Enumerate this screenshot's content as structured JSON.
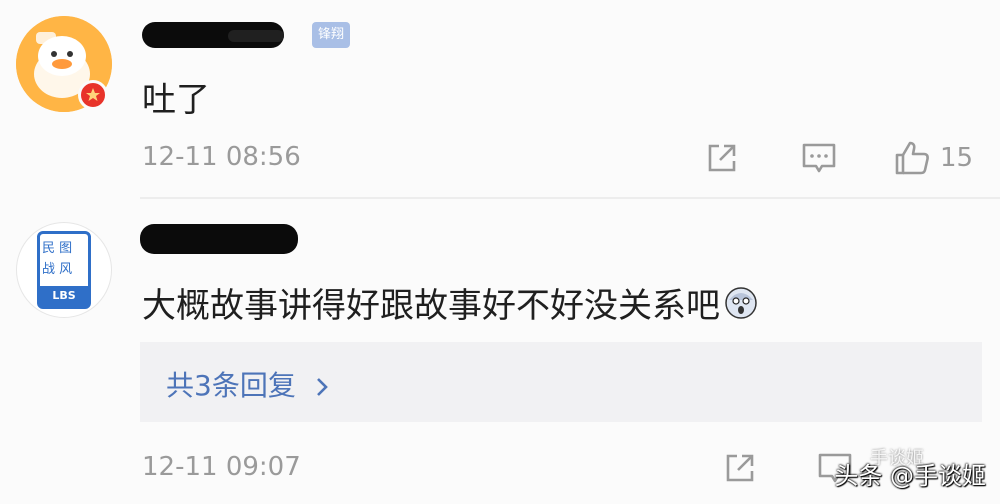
{
  "comments": [
    {
      "tag": "锋翔",
      "text": "吐了",
      "time": "12-11 08:56",
      "likes": "15"
    },
    {
      "text": "大概故事讲得好跟故事好不好没关系吧",
      "time": "12-11 09:07",
      "replies_label": "共3条回复"
    }
  ],
  "avatar2": {
    "line1": "民 图",
    "line2": "战 风",
    "line3": "LBS"
  },
  "watermark": {
    "main": "头条 @手谈姬",
    "faint": "手谈姬"
  },
  "icons": {
    "share": "share-icon",
    "comment": "comment-icon",
    "like": "thumbs-up-icon",
    "chevron": "chevron-right-icon"
  },
  "colors": {
    "link_blue": "#4d74b8",
    "meta_gray": "#9a9a9a",
    "badge_red": "#e8332a",
    "avatar_orange": "#ffb545",
    "tag_blue": "#a9bfe6"
  }
}
